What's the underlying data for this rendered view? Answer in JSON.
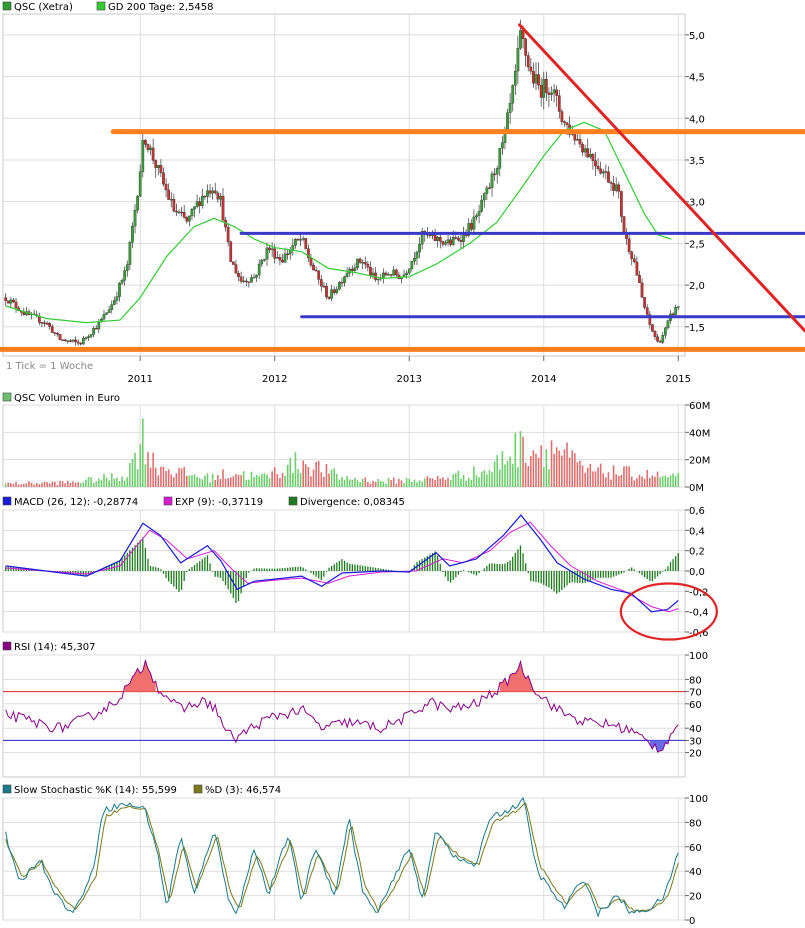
{
  "chart_data": [
    {
      "type": "candlestick",
      "panel": "price",
      "legend": [
        {
          "label": "QSC (Xetra)",
          "color": "#2e9e2e"
        },
        {
          "label": "GD 200 Tage: 2,5458",
          "color": "#33cc33"
        }
      ],
      "note": "1 Tick = 1 Woche",
      "x_ticks": [
        "2011",
        "2012",
        "2013",
        "2014",
        "2015"
      ],
      "y_ticks": [
        "1,5",
        "2,0",
        "2,5",
        "3,0",
        "3,5",
        "4,0",
        "4,5",
        "5,0"
      ],
      "ylim": [
        1.15,
        5.25
      ],
      "price_points": [
        [
          2010.0,
          1.85
        ],
        [
          2010.15,
          1.65
        ],
        [
          2010.3,
          1.55
        ],
        [
          2010.4,
          1.35
        ],
        [
          2010.55,
          1.3
        ],
        [
          2010.7,
          1.55
        ],
        [
          2010.8,
          1.8
        ],
        [
          2010.9,
          2.2
        ],
        [
          2010.97,
          3.0
        ],
        [
          2011.03,
          3.8
        ],
        [
          2011.15,
          3.3
        ],
        [
          2011.25,
          2.9
        ],
        [
          2011.35,
          2.75
        ],
        [
          2011.45,
          3.05
        ],
        [
          2011.55,
          3.2
        ],
        [
          2011.6,
          3.0
        ],
        [
          2011.67,
          2.3
        ],
        [
          2011.75,
          2.05
        ],
        [
          2011.85,
          2.1
        ],
        [
          2011.95,
          2.45
        ],
        [
          2012.05,
          2.3
        ],
        [
          2012.15,
          2.5
        ],
        [
          2012.2,
          2.55
        ],
        [
          2012.27,
          2.25
        ],
        [
          2012.33,
          2.05
        ],
        [
          2012.4,
          1.85
        ],
        [
          2012.47,
          2.0
        ],
        [
          2012.55,
          2.2
        ],
        [
          2012.65,
          2.3
        ],
        [
          2012.75,
          2.05
        ],
        [
          2012.85,
          2.15
        ],
        [
          2012.95,
          2.1
        ],
        [
          2013.02,
          2.3
        ],
        [
          2013.1,
          2.6
        ],
        [
          2013.2,
          2.55
        ],
        [
          2013.3,
          2.5
        ],
        [
          2013.4,
          2.6
        ],
        [
          2013.5,
          2.8
        ],
        [
          2013.6,
          3.2
        ],
        [
          2013.7,
          3.7
        ],
        [
          2013.78,
          4.4
        ],
        [
          2013.83,
          5.0
        ],
        [
          2013.9,
          4.55
        ],
        [
          2013.97,
          4.35
        ],
        [
          2014.05,
          4.4
        ],
        [
          2014.15,
          3.95
        ],
        [
          2014.25,
          3.75
        ],
        [
          2014.35,
          3.55
        ],
        [
          2014.45,
          3.35
        ],
        [
          2014.55,
          3.15
        ],
        [
          2014.6,
          2.6
        ],
        [
          2014.67,
          2.3
        ],
        [
          2014.73,
          1.85
        ],
        [
          2014.78,
          1.55
        ],
        [
          2014.85,
          1.3
        ],
        [
          2014.9,
          1.45
        ],
        [
          2014.95,
          1.65
        ],
        [
          2015.0,
          1.75
        ]
      ],
      "ma200_points": [
        [
          2010.0,
          1.75
        ],
        [
          2010.3,
          1.6
        ],
        [
          2010.6,
          1.55
        ],
        [
          2010.85,
          1.58
        ],
        [
          2011.0,
          1.85
        ],
        [
          2011.2,
          2.35
        ],
        [
          2011.4,
          2.7
        ],
        [
          2011.55,
          2.8
        ],
        [
          2011.7,
          2.7
        ],
        [
          2011.85,
          2.55
        ],
        [
          2012.0,
          2.45
        ],
        [
          2012.2,
          2.4
        ],
        [
          2012.4,
          2.2
        ],
        [
          2012.6,
          2.15
        ],
        [
          2012.8,
          2.08
        ],
        [
          2013.0,
          2.1
        ],
        [
          2013.2,
          2.25
        ],
        [
          2013.45,
          2.5
        ],
        [
          2013.65,
          2.75
        ],
        [
          2013.85,
          3.2
        ],
        [
          2014.0,
          3.55
        ],
        [
          2014.15,
          3.85
        ],
        [
          2014.3,
          3.95
        ],
        [
          2014.45,
          3.85
        ],
        [
          2014.6,
          3.35
        ],
        [
          2014.75,
          2.85
        ],
        [
          2014.85,
          2.6
        ],
        [
          2014.95,
          2.55
        ]
      ],
      "trendlines": [
        {
          "kind": "support",
          "color": "#ff7f1e",
          "points": [
            [
              2009.82,
              1.23
            ],
            [
              2015.95,
              1.23
            ]
          ]
        },
        {
          "kind": "resistance",
          "color": "#ff7f1e",
          "points": [
            [
              2010.8,
              3.84
            ],
            [
              2015.95,
              3.84
            ]
          ]
        },
        {
          "kind": "channel",
          "color": "#3939c8",
          "points": [
            [
              2011.75,
              2.62
            ],
            [
              2015.95,
              2.62
            ]
          ]
        },
        {
          "kind": "channel",
          "color": "#3939c8",
          "points": [
            [
              2012.2,
              1.62
            ],
            [
              2015.95,
              1.62
            ]
          ]
        },
        {
          "kind": "downtrend",
          "color": "#e02424",
          "points": [
            [
              2013.82,
              5.12
            ],
            [
              2015.95,
              1.45
            ]
          ]
        }
      ]
    },
    {
      "type": "bar",
      "panel": "volume",
      "legend": [
        {
          "label": "QSC Volumen in Euro",
          "color": "#6fbf6f"
        }
      ],
      "y_ticks": [
        "0M",
        "20M",
        "40M",
        "60M"
      ],
      "ylim": [
        0,
        60
      ],
      "unit": "M",
      "volume_points": [
        [
          2010.0,
          3
        ],
        [
          2010.5,
          4
        ],
        [
          2010.9,
          10
        ],
        [
          2011.02,
          43
        ],
        [
          2011.1,
          20
        ],
        [
          2011.2,
          16
        ],
        [
          2011.3,
          12
        ],
        [
          2011.5,
          8
        ],
        [
          2011.7,
          12
        ],
        [
          2011.9,
          8
        ],
        [
          2012.2,
          22
        ],
        [
          2012.5,
          8
        ],
        [
          2012.8,
          5
        ],
        [
          2013.2,
          7
        ],
        [
          2013.6,
          14
        ],
        [
          2013.75,
          30
        ],
        [
          2013.85,
          35
        ],
        [
          2013.95,
          32
        ],
        [
          2014.1,
          33
        ],
        [
          2014.3,
          14
        ],
        [
          2014.6,
          12
        ],
        [
          2014.8,
          10
        ],
        [
          2014.95,
          8
        ]
      ]
    },
    {
      "type": "line",
      "panel": "macd",
      "legend": [
        {
          "label": "MACD (26, 12): -0,28774",
          "color": "#1a1adb"
        },
        {
          "label": "EXP (9): -0,37119",
          "color": "#d91ad9"
        },
        {
          "label": "Divergence: 0,08345",
          "color": "#1e7a1e"
        }
      ],
      "y_ticks": [
        "-0,6",
        "-0,4",
        "-0,2",
        "0,0",
        "0,2",
        "0,4",
        "0,6"
      ],
      "ylim": [
        -0.6,
        0.6
      ],
      "macd_points": [
        [
          2010.0,
          0.05
        ],
        [
          2010.3,
          0.0
        ],
        [
          2010.6,
          -0.05
        ],
        [
          2010.85,
          0.1
        ],
        [
          2011.02,
          0.47
        ],
        [
          2011.15,
          0.35
        ],
        [
          2011.3,
          0.08
        ],
        [
          2011.5,
          0.25
        ],
        [
          2011.6,
          0.1
        ],
        [
          2011.72,
          -0.18
        ],
        [
          2011.85,
          -0.1
        ],
        [
          2012.0,
          -0.08
        ],
        [
          2012.2,
          -0.05
        ],
        [
          2012.35,
          -0.15
        ],
        [
          2012.5,
          -0.02
        ],
        [
          2012.8,
          0.0
        ],
        [
          2013.0,
          -0.01
        ],
        [
          2013.2,
          0.18
        ],
        [
          2013.3,
          0.05
        ],
        [
          2013.5,
          0.12
        ],
        [
          2013.7,
          0.35
        ],
        [
          2013.83,
          0.55
        ],
        [
          2013.97,
          0.32
        ],
        [
          2014.1,
          0.08
        ],
        [
          2014.3,
          -0.08
        ],
        [
          2014.5,
          -0.18
        ],
        [
          2014.65,
          -0.22
        ],
        [
          2014.8,
          -0.4
        ],
        [
          2014.92,
          -0.38
        ],
        [
          2015.0,
          -0.29
        ]
      ],
      "signal_points": [
        [
          2010.0,
          0.03
        ],
        [
          2010.3,
          0.0
        ],
        [
          2010.6,
          -0.03
        ],
        [
          2010.85,
          0.05
        ],
        [
          2011.07,
          0.4
        ],
        [
          2011.2,
          0.3
        ],
        [
          2011.35,
          0.12
        ],
        [
          2011.55,
          0.2
        ],
        [
          2011.68,
          0.02
        ],
        [
          2011.8,
          -0.12
        ],
        [
          2012.0,
          -0.09
        ],
        [
          2012.2,
          -0.07
        ],
        [
          2012.4,
          -0.12
        ],
        [
          2012.55,
          -0.05
        ],
        [
          2012.8,
          -0.01
        ],
        [
          2013.05,
          0.0
        ],
        [
          2013.25,
          0.12
        ],
        [
          2013.4,
          0.08
        ],
        [
          2013.6,
          0.2
        ],
        [
          2013.75,
          0.38
        ],
        [
          2013.9,
          0.48
        ],
        [
          2014.05,
          0.25
        ],
        [
          2014.2,
          0.05
        ],
        [
          2014.4,
          -0.1
        ],
        [
          2014.6,
          -0.2
        ],
        [
          2014.8,
          -0.35
        ],
        [
          2014.93,
          -0.4
        ],
        [
          2015.0,
          -0.37
        ]
      ],
      "annotation": {
        "kind": "ellipse",
        "color": "#e02424",
        "x": 2014.93,
        "y": -0.32
      }
    },
    {
      "type": "line",
      "panel": "rsi",
      "legend": [
        {
          "label": "RSI (14): 45,307",
          "color": "#880088"
        }
      ],
      "y_ticks": [
        "20",
        "30",
        "40",
        "60",
        "70",
        "80",
        "100"
      ],
      "ylim": [
        0,
        100
      ],
      "levels": [
        {
          "value": 70,
          "color": "#e02424"
        },
        {
          "value": 30,
          "color": "#2828c8"
        }
      ],
      "rsi_points": [
        [
          2010.0,
          52
        ],
        [
          2010.2,
          45
        ],
        [
          2010.4,
          40
        ],
        [
          2010.6,
          48
        ],
        [
          2010.8,
          60
        ],
        [
          2010.95,
          80
        ],
        [
          2011.05,
          95
        ],
        [
          2011.12,
          75
        ],
        [
          2011.3,
          55
        ],
        [
          2011.45,
          62
        ],
        [
          2011.55,
          58
        ],
        [
          2011.65,
          35
        ],
        [
          2011.72,
          32
        ],
        [
          2011.85,
          42
        ],
        [
          2012.0,
          50
        ],
        [
          2012.2,
          55
        ],
        [
          2012.35,
          40
        ],
        [
          2012.55,
          45
        ],
        [
          2012.8,
          40
        ],
        [
          2013.0,
          50
        ],
        [
          2013.15,
          62
        ],
        [
          2013.3,
          55
        ],
        [
          2013.5,
          60
        ],
        [
          2013.7,
          75
        ],
        [
          2013.82,
          92
        ],
        [
          2013.95,
          70
        ],
        [
          2014.1,
          55
        ],
        [
          2014.3,
          45
        ],
        [
          2014.5,
          43
        ],
        [
          2014.65,
          38
        ],
        [
          2014.78,
          28
        ],
        [
          2014.87,
          23
        ],
        [
          2014.95,
          35
        ],
        [
          2015.0,
          45
        ]
      ]
    },
    {
      "type": "line",
      "panel": "stochastic",
      "legend": [
        {
          "label": "Slow Stochastic %K (14): 55,599",
          "color": "#1a7a8c"
        },
        {
          "label": "%D (3): 46,574",
          "color": "#7a7a1a"
        }
      ],
      "y_ticks": [
        "0",
        "20",
        "40",
        "60",
        "80",
        "100"
      ],
      "ylim": [
        0,
        100
      ],
      "k_points": [
        [
          2010.0,
          70
        ],
        [
          2010.1,
          30
        ],
        [
          2010.25,
          50
        ],
        [
          2010.38,
          20
        ],
        [
          2010.5,
          5
        ],
        [
          2010.65,
          40
        ],
        [
          2010.72,
          90
        ],
        [
          2010.88,
          95
        ],
        [
          2011.03,
          92
        ],
        [
          2011.12,
          60
        ],
        [
          2011.2,
          10
        ],
        [
          2011.3,
          70
        ],
        [
          2011.4,
          20
        ],
        [
          2011.55,
          75
        ],
        [
          2011.65,
          20
        ],
        [
          2011.72,
          5
        ],
        [
          2011.85,
          60
        ],
        [
          2011.95,
          20
        ],
        [
          2012.1,
          70
        ],
        [
          2012.2,
          15
        ],
        [
          2012.3,
          60
        ],
        [
          2012.45,
          20
        ],
        [
          2012.55,
          85
        ],
        [
          2012.65,
          25
        ],
        [
          2012.75,
          5
        ],
        [
          2012.85,
          25
        ],
        [
          2013.0,
          60
        ],
        [
          2013.1,
          15
        ],
        [
          2013.2,
          75
        ],
        [
          2013.35,
          50
        ],
        [
          2013.5,
          45
        ],
        [
          2013.6,
          85
        ],
        [
          2013.75,
          90
        ],
        [
          2013.85,
          99
        ],
        [
          2013.95,
          40
        ],
        [
          2014.05,
          25
        ],
        [
          2014.15,
          10
        ],
        [
          2014.3,
          35
        ],
        [
          2014.4,
          5
        ],
        [
          2014.55,
          20
        ],
        [
          2014.65,
          5
        ],
        [
          2014.8,
          10
        ],
        [
          2014.9,
          20
        ],
        [
          2015.0,
          56
        ]
      ],
      "d_points": [
        [
          2010.0,
          65
        ],
        [
          2010.12,
          35
        ],
        [
          2010.27,
          48
        ],
        [
          2010.4,
          22
        ],
        [
          2010.52,
          8
        ],
        [
          2010.67,
          35
        ],
        [
          2010.74,
          85
        ],
        [
          2010.9,
          93
        ],
        [
          2011.05,
          90
        ],
        [
          2011.14,
          55
        ],
        [
          2011.22,
          14
        ],
        [
          2011.32,
          62
        ],
        [
          2011.42,
          25
        ],
        [
          2011.57,
          70
        ],
        [
          2011.67,
          24
        ],
        [
          2011.74,
          8
        ],
        [
          2011.87,
          55
        ],
        [
          2011.97,
          24
        ],
        [
          2012.12,
          65
        ],
        [
          2012.22,
          18
        ],
        [
          2012.32,
          55
        ],
        [
          2012.47,
          23
        ],
        [
          2012.57,
          80
        ],
        [
          2012.67,
          28
        ],
        [
          2012.77,
          8
        ],
        [
          2012.87,
          22
        ],
        [
          2013.02,
          55
        ],
        [
          2013.12,
          18
        ],
        [
          2013.22,
          70
        ],
        [
          2013.37,
          52
        ],
        [
          2013.52,
          45
        ],
        [
          2013.62,
          80
        ],
        [
          2013.77,
          88
        ],
        [
          2013.87,
          95
        ],
        [
          2013.97,
          45
        ],
        [
          2014.07,
          28
        ],
        [
          2014.17,
          13
        ],
        [
          2014.32,
          32
        ],
        [
          2014.42,
          8
        ],
        [
          2014.57,
          18
        ],
        [
          2014.67,
          7
        ],
        [
          2014.82,
          10
        ],
        [
          2014.92,
          18
        ],
        [
          2015.0,
          47
        ]
      ]
    }
  ],
  "colors": {
    "up": "#3c9c3c",
    "down": "#c43232",
    "grid": "#dddddd",
    "rsi_over": "#f07070",
    "rsi_under": "#6a6ae6"
  }
}
